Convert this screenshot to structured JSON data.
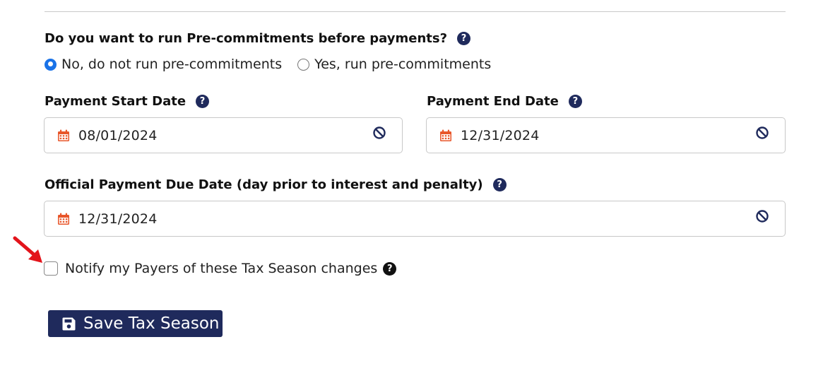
{
  "precommit": {
    "question": "Do you want to run Pre-commitments before payments?",
    "options": [
      {
        "label": "No, do not run pre-commitments",
        "checked": true
      },
      {
        "label": "Yes, run pre-commitments",
        "checked": false
      }
    ]
  },
  "payment_start": {
    "label": "Payment Start Date",
    "value": "08/01/2024"
  },
  "payment_end": {
    "label": "Payment End Date",
    "value": "12/31/2024"
  },
  "official_due": {
    "label": "Official Payment Due Date (day prior to interest and penalty)",
    "value": "12/31/2024"
  },
  "notify": {
    "label": "Notify my Payers of these Tax Season changes",
    "checked": false
  },
  "save_button": {
    "label": "Save Tax Season"
  },
  "icons": {
    "help": "question-circle-icon",
    "calendar": "calendar-icon",
    "clear": "ban-icon",
    "save": "floppy-disk-icon",
    "annotation": "red-arrow-icon"
  },
  "colors": {
    "navy": "#1f2a5c",
    "calendar_orange": "#e8562a",
    "radio_blue": "#1a73e8",
    "arrow_red": "#e3141b"
  },
  "help_glyph": "?"
}
